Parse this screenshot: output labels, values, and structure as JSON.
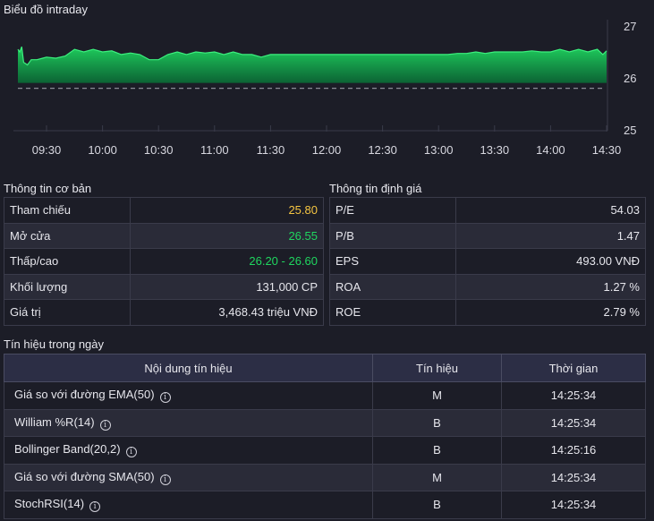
{
  "chart": {
    "title": "Biểu đồ intraday",
    "y_ticks": [
      "27",
      "26",
      "25"
    ],
    "x_ticks": [
      "09:30",
      "10:00",
      "10:30",
      "11:00",
      "11:30",
      "12:00",
      "12:30",
      "13:00",
      "13:30",
      "14:00",
      "14:30"
    ],
    "colors": {
      "area": "#1fd65f",
      "reference_line": "#8a8b96",
      "grid": "#3a3b4a"
    }
  },
  "chart_data": {
    "type": "area",
    "ylim": [
      25,
      27
    ],
    "reference": 25.8,
    "x": [
      "09:15",
      "09:16",
      "09:17",
      "09:18",
      "09:20",
      "09:22",
      "09:25",
      "09:28",
      "09:30",
      "09:35",
      "09:40",
      "09:45",
      "09:50",
      "09:55",
      "10:00",
      "10:05",
      "10:10",
      "10:15",
      "10:20",
      "10:25",
      "10:30",
      "10:35",
      "10:40",
      "10:45",
      "10:50",
      "10:55",
      "11:00",
      "11:05",
      "11:10",
      "11:15",
      "11:20",
      "11:25",
      "11:30",
      "11:35",
      "11:40",
      "11:45",
      "11:50",
      "11:55",
      "12:00",
      "12:30",
      "13:00",
      "13:05",
      "13:10",
      "13:15",
      "13:20",
      "13:25",
      "13:30",
      "13:35",
      "13:40",
      "13:45",
      "13:50",
      "13:55",
      "14:00",
      "14:05",
      "14:10",
      "14:15",
      "14:20",
      "14:25",
      "14:28",
      "14:30"
    ],
    "values": [
      26.55,
      26.5,
      26.6,
      26.3,
      26.25,
      26.35,
      26.35,
      26.38,
      26.4,
      26.38,
      26.42,
      26.55,
      26.5,
      26.55,
      26.5,
      26.52,
      26.45,
      26.48,
      26.45,
      26.35,
      26.35,
      26.45,
      26.5,
      26.45,
      26.5,
      26.48,
      26.5,
      26.45,
      26.5,
      26.45,
      26.45,
      26.4,
      26.45,
      26.45,
      26.45,
      26.45,
      26.45,
      26.45,
      26.45,
      26.45,
      26.45,
      26.45,
      26.47,
      26.47,
      26.5,
      26.47,
      26.5,
      26.5,
      26.5,
      26.5,
      26.52,
      26.5,
      26.5,
      26.55,
      26.5,
      26.55,
      26.5,
      26.55,
      26.45,
      26.52
    ]
  },
  "basic_info": {
    "title": "Thông tin cơ bản",
    "rows": [
      {
        "label": "Tham chiếu",
        "value": "25.80",
        "color": "#f5c542"
      },
      {
        "label": "Mở cửa",
        "value": "26.55",
        "color": "#1fd65f"
      },
      {
        "label": "Thấp/cao",
        "value": "26.20 - 26.60",
        "color": "#1fd65f"
      },
      {
        "label": "Khối lượng",
        "value": "131,000 CP",
        "color": ""
      },
      {
        "label": "Giá trị",
        "value": "3,468.43 triệu VNĐ",
        "color": ""
      }
    ]
  },
  "valuation": {
    "title": "Thông tin định giá",
    "rows": [
      {
        "label": "P/E",
        "value": "54.03"
      },
      {
        "label": "P/B",
        "value": "1.47"
      },
      {
        "label": "EPS",
        "value": "493.00 VNĐ"
      },
      {
        "label": "ROA",
        "value": "1.27 %"
      },
      {
        "label": "ROE",
        "value": "2.79 %"
      }
    ]
  },
  "signals": {
    "title": "Tín hiệu trong ngày",
    "headers": [
      "Nội dung tín hiệu",
      "Tín hiệu",
      "Thời gian"
    ],
    "rows": [
      {
        "name": "Giá so với đường EMA(50)",
        "signal": "M",
        "time": "14:25:34"
      },
      {
        "name": "William %R(14)",
        "signal": "B",
        "time": "14:25:34"
      },
      {
        "name": "Bollinger Band(20,2)",
        "signal": "B",
        "time": "14:25:16"
      },
      {
        "name": "Giá so với đường SMA(50)",
        "signal": "M",
        "time": "14:25:34"
      },
      {
        "name": "StochRSI(14)",
        "signal": "B",
        "time": "14:25:34"
      }
    ],
    "info_icon": "info-circle-icon"
  }
}
